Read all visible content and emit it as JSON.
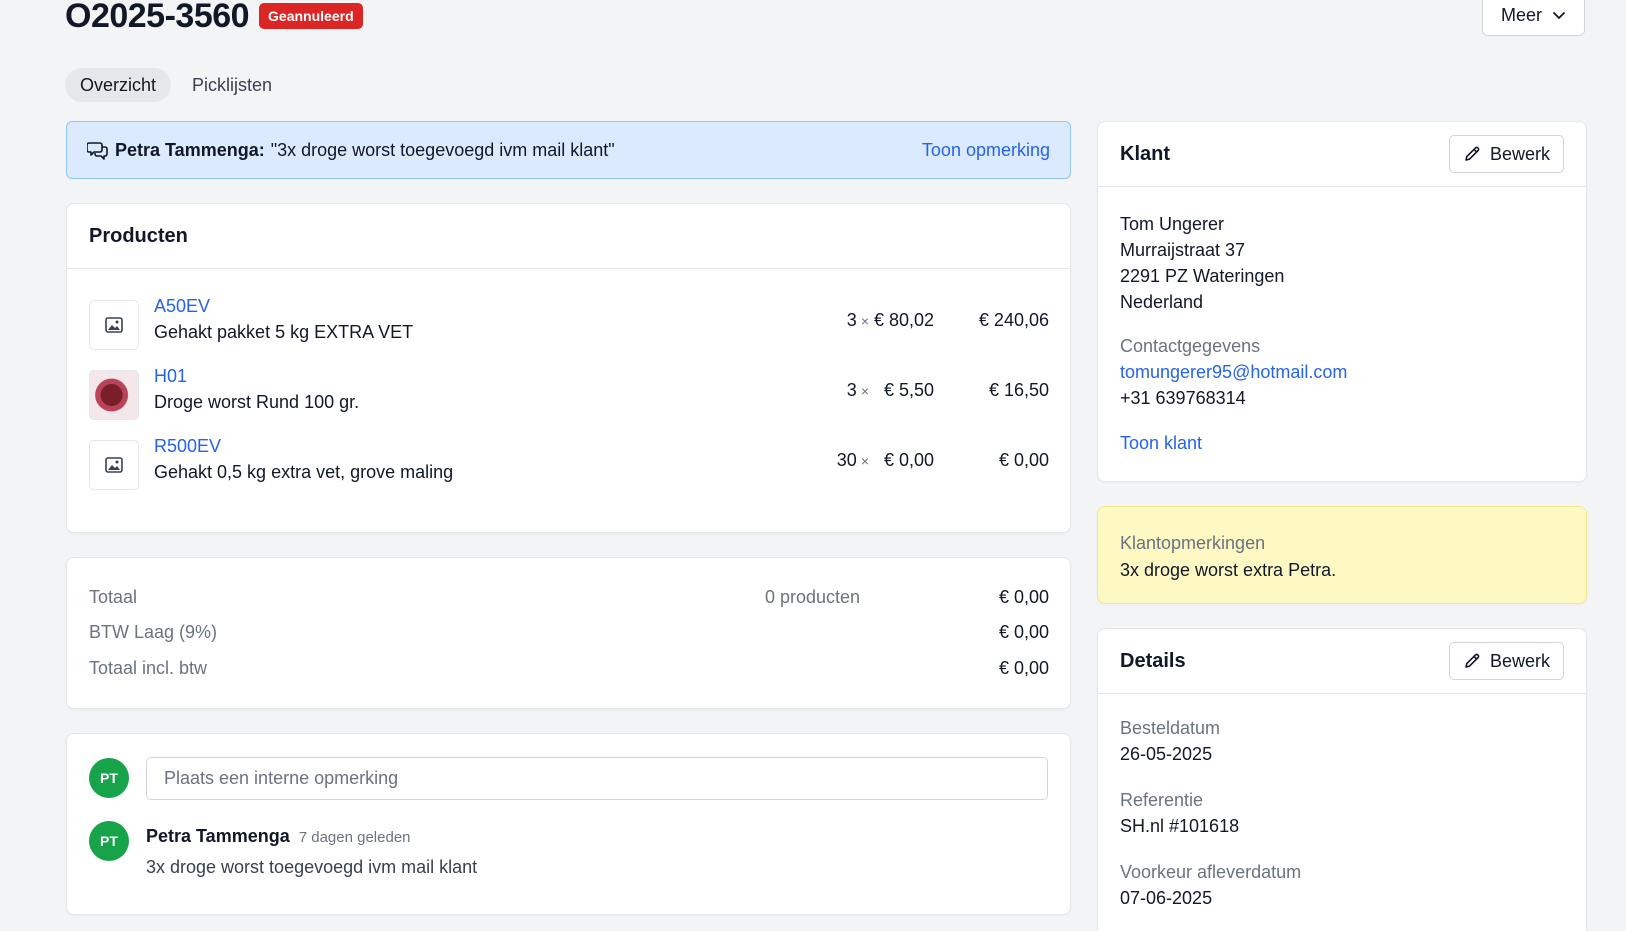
{
  "header": {
    "order_number": "O2025-3560",
    "status_badge": "Geannuleerd",
    "more_button": "Meer"
  },
  "tabs": [
    {
      "label": "Overzicht",
      "active": true
    },
    {
      "label": "Picklijsten",
      "active": false
    }
  ],
  "remark_banner": {
    "author": "Petra Tammenga:",
    "text": "\"3x droge worst toegevoegd ivm mail klant\"",
    "toggle_label": "Toon opmerking"
  },
  "products": {
    "title": "Producten",
    "items": [
      {
        "sku": "A50EV",
        "name": "Gehakt pakket 5 kg EXTRA VET",
        "qty": "3",
        "price": "€ 80,02",
        "total": "€ 240,06",
        "has_photo": false
      },
      {
        "sku": "H01",
        "name": "Droge worst Rund 100 gr.",
        "qty": "3",
        "price": "€ 5,50",
        "total": "€ 16,50",
        "has_photo": true
      },
      {
        "sku": "R500EV",
        "name": "Gehakt 0,5 kg extra vet, grove maling",
        "qty": "30",
        "price": "€ 0,00",
        "total": "€ 0,00",
        "has_photo": false
      }
    ],
    "times_symbol": "×"
  },
  "totals": {
    "total_label": "Totaal",
    "product_count": "0 producten",
    "total_value": "€ 0,00",
    "vat_label": "BTW Laag (9%)",
    "vat_value": "€ 0,00",
    "incl_label": "Totaal incl. btw",
    "incl_value": "€ 0,00"
  },
  "comments": {
    "input_placeholder": "Plaats een interne opmerking",
    "current_user_initials": "PT",
    "items": [
      {
        "initials": "PT",
        "author": "Petra Tammenga",
        "time": "7 dagen geleden",
        "text": "3x droge worst toegevoegd ivm mail klant"
      }
    ]
  },
  "customer": {
    "title": "Klant",
    "edit_label": "Bewerk",
    "name": "Tom Ungerer",
    "street": "Murraijstraat 37",
    "city": "2291 PZ Wateringen",
    "country": "Nederland",
    "contact_label": "Contactgegevens",
    "email": "tomungerer95@hotmail.com",
    "phone": "+31 639768314",
    "show_customer_link": "Toon klant"
  },
  "customer_notes": {
    "label": "Klantopmerkingen",
    "text": "3x droge worst extra Petra."
  },
  "details": {
    "title": "Details",
    "edit_label": "Bewerk",
    "order_date_label": "Besteldatum",
    "order_date": "26-05-2025",
    "reference_label": "Referentie",
    "reference": "SH.nl #101618",
    "preferred_delivery_label": "Voorkeur afleverdatum",
    "preferred_delivery": "07-06-2025"
  },
  "colors": {
    "accent": "#2563eb",
    "danger": "#dc2626",
    "avatar": "#16a34a",
    "banner_bg": "#dbeafe",
    "notes_bg": "#fef9c3"
  }
}
